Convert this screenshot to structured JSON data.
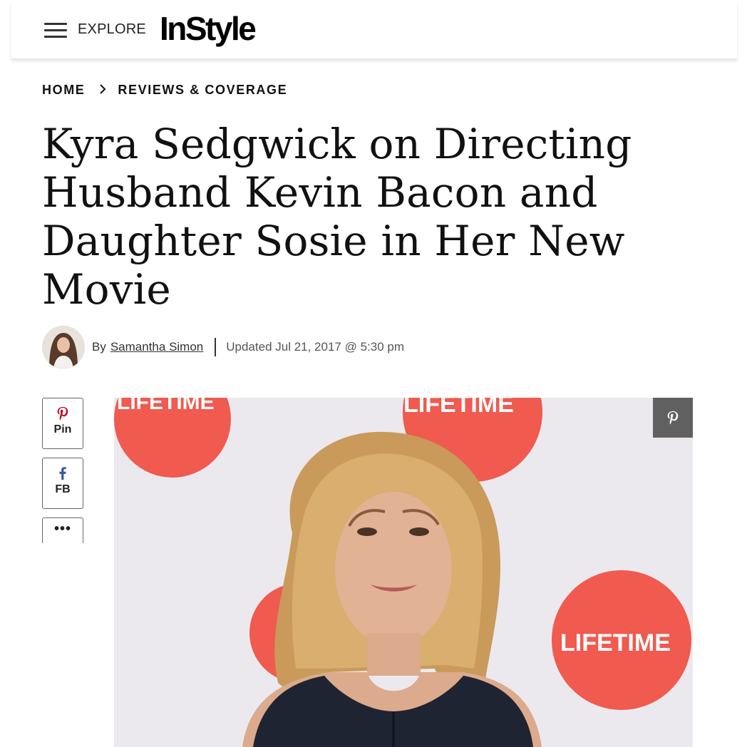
{
  "header": {
    "explore_label": "EXPLORE",
    "logo_text": "InStyle"
  },
  "breadcrumb": {
    "home": "HOME",
    "separator": ">",
    "section": "REVIEWS & COVERAGE"
  },
  "article": {
    "title": "Kyra Sedgwick on Directing Husband Kevin Bacon and Daughter Sosie in Her New Movie",
    "by_label": "By",
    "author": "Samantha Simon",
    "updated": "Updated Jul 21, 2017 @ 5:30 pm"
  },
  "share": {
    "pin_label": "Pin",
    "fb_label": "FB",
    "more_label": "•••"
  },
  "hero": {
    "backdrop_logos": [
      "LIFETIME",
      "LIFETIME",
      "LIFETIME"
    ],
    "backdrop_color": "#f05a4f"
  },
  "colors": {
    "pinterest": "#bd081c",
    "facebook": "#3b5998",
    "overlay": "#555555"
  },
  "icons": [
    "menu-icon",
    "chevron-right-icon",
    "pinterest-icon",
    "facebook-icon",
    "more-icon"
  ]
}
